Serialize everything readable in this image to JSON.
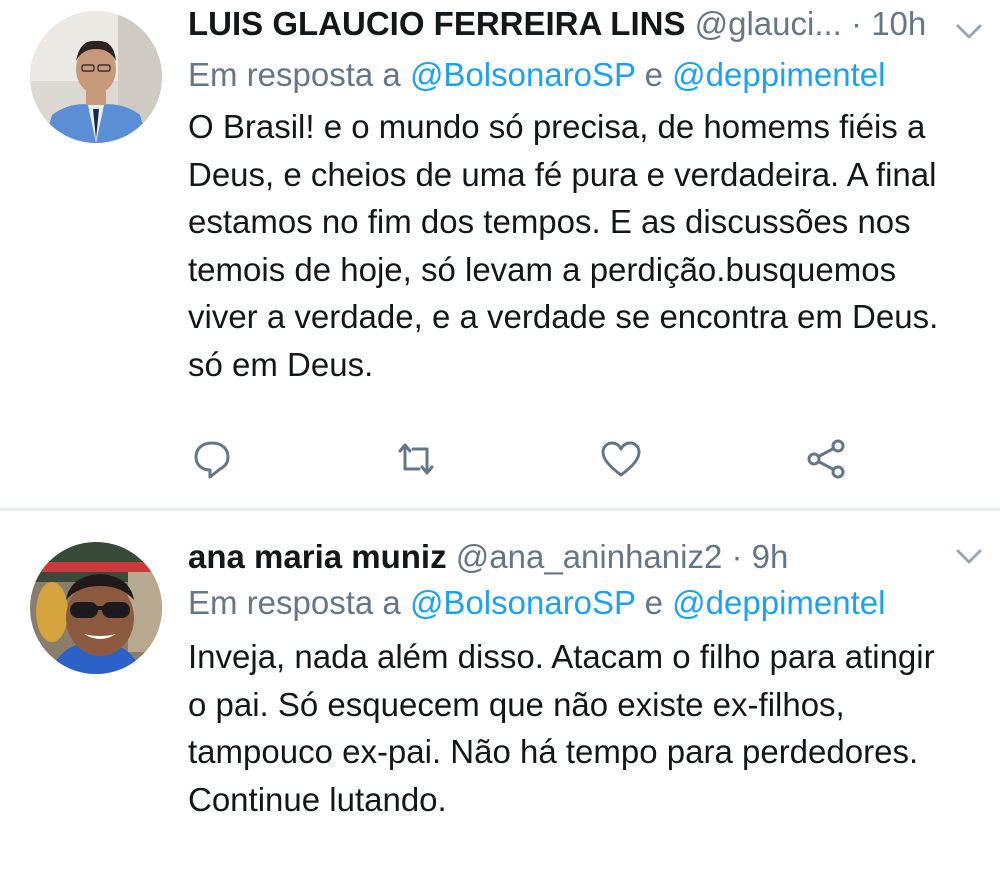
{
  "tweets": [
    {
      "name": "LUIS GLAUCIO FERREIRA LINS",
      "handle": "@glauci...",
      "dot": "·",
      "time": "10h",
      "reply_prefix": "Em resposta a",
      "reply_mention_1": "@BolsonaroSP",
      "reply_conj": "e",
      "reply_mention_2": "@deppimentel",
      "text": "O Brasil! e o mundo só precisa, de homems fiéis a\nDeus, e cheios de uma fé pura e verdadeira. A final\nestamos no fim dos tempos. E as discussões nos\ntemois de hoje, só levam a perdição.busquemos\nviver a verdade, e a verdade se encontra em Deus.\nsó em Deus.",
      "icons": [
        "reply-icon",
        "retweet-icon",
        "like-icon",
        "share-icon"
      ]
    },
    {
      "name": "ana maria muniz",
      "handle": "@ana_aninhaniz2",
      "dot": "·",
      "time": "9h",
      "reply_prefix": "Em resposta a",
      "reply_mention_1": "@BolsonaroSP",
      "reply_conj": "e",
      "reply_mention_2": "@deppimentel",
      "text": "Inveja, nada além disso. Atacam o filho para atingir\no pai. Só esquecem que não existe ex-filhos,\ntampouco ex-pai. Não há tempo para perdedores.\nContinue lutando."
    }
  ],
  "colors": {
    "text": "#14171a",
    "secondary": "#657786",
    "link": "#1da1f2",
    "divider": "#e6ecf0"
  }
}
